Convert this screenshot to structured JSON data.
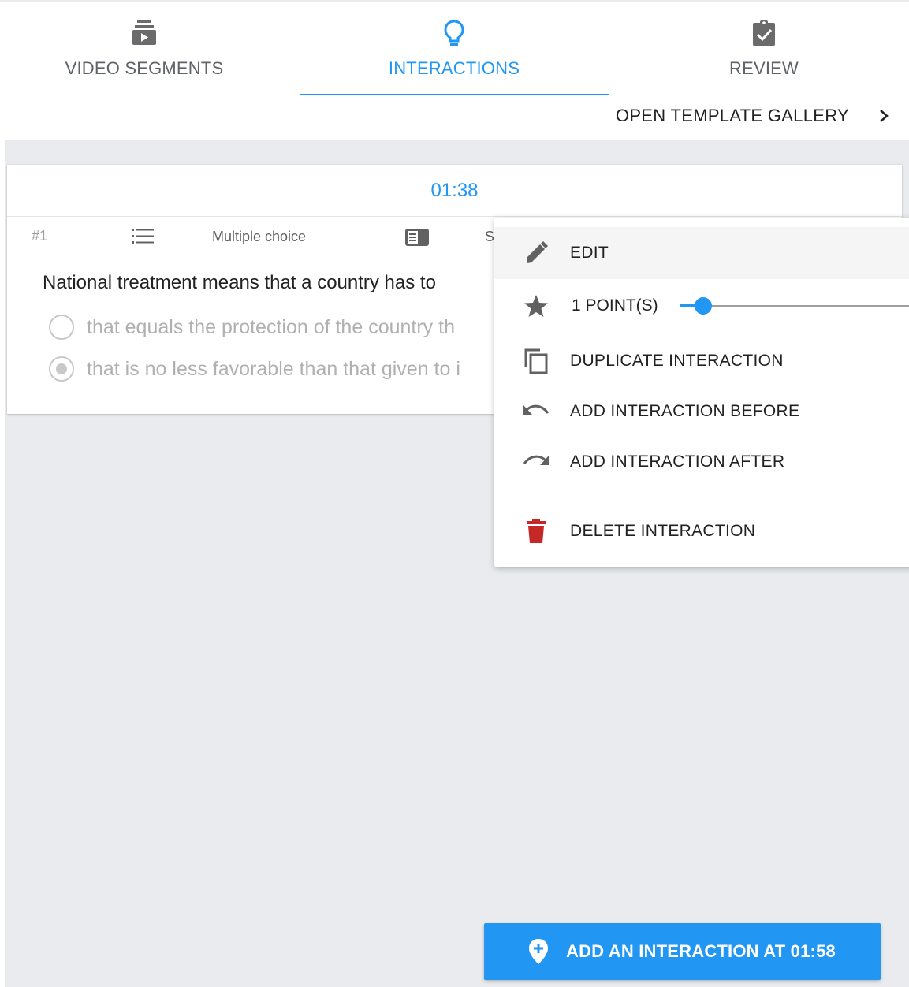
{
  "tabs": [
    {
      "label": "VIDEO SEGMENTS",
      "icon": "video-stack-icon",
      "active": false
    },
    {
      "label": "INTERACTIONS",
      "icon": "lightbulb-icon",
      "active": true
    },
    {
      "label": "REVIEW",
      "icon": "clipboard-check-icon",
      "active": false
    }
  ],
  "gallery": {
    "label": "OPEN TEMPLATE GALLERY",
    "icon": "chevron-right-icon"
  },
  "card": {
    "time": "01:38",
    "number": "#1",
    "type": "Multiple choice",
    "truncated_label": "S",
    "question": "National treatment means that a country has to",
    "options": [
      {
        "text": "that equals the protection of the country th",
        "selected": false
      },
      {
        "text": "that is no less favorable than that given to i",
        "selected": true
      }
    ]
  },
  "menu": {
    "edit": "EDIT",
    "points": "1 POINT(S)",
    "points_value": 1,
    "duplicate": "DUPLICATE INTERACTION",
    "add_before": "ADD INTERACTION BEFORE",
    "add_after": "ADD INTERACTION AFTER",
    "delete": "DELETE INTERACTION"
  },
  "add_button": {
    "label": "ADD AN INTERACTION AT 01:58",
    "icon": "map-pin-plus-icon"
  },
  "colors": {
    "accent": "#2196f3",
    "delete": "#c62828",
    "workspace": "#e9ebee"
  }
}
